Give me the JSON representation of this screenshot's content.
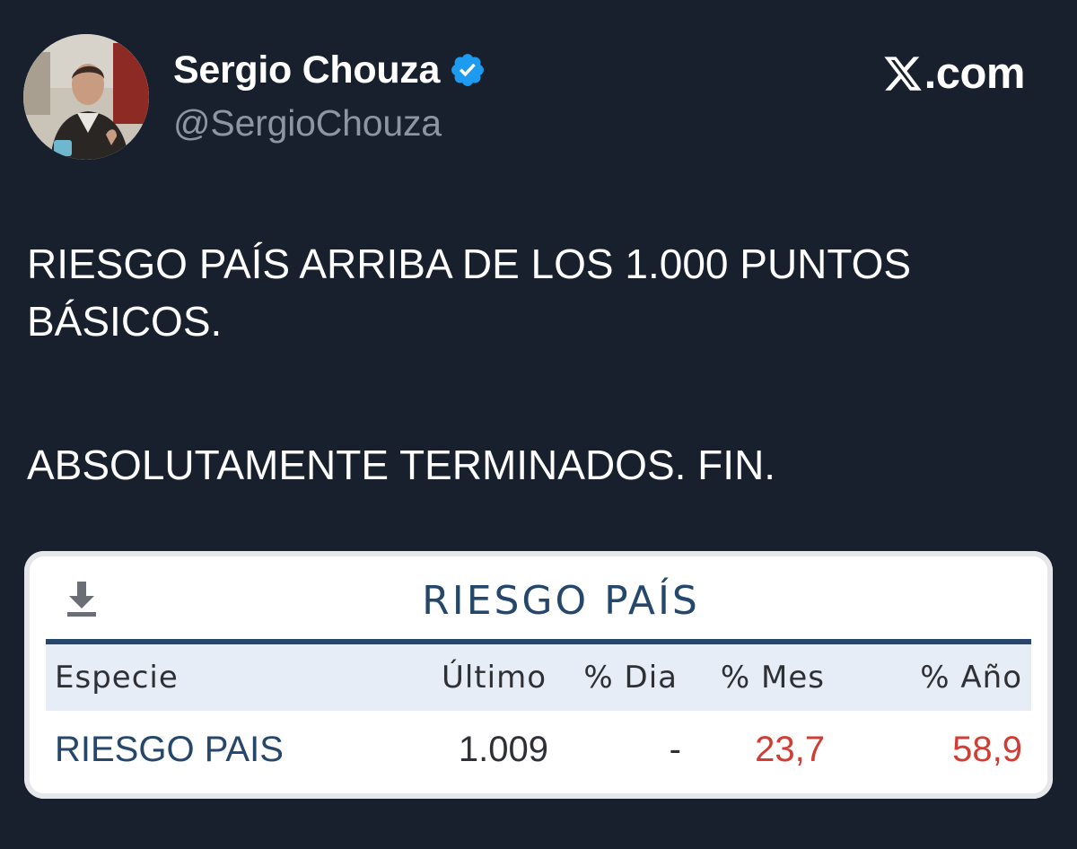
{
  "author": {
    "name": "Sergio Chouza",
    "handle": "@SergioChouza",
    "verified_color": "#1d9bf0"
  },
  "brand": {
    "site": ".com",
    "icon": "x-logo-icon"
  },
  "tweet": {
    "paragraphs": [
      "RIESGO PAÍS ARRIBA DE LOS 1.000 PUNTOS BÁSICOS.",
      "ABSOLUTAMENTE TERMINADOS. FIN."
    ]
  },
  "media": {
    "title": "RIESGO PAÍS",
    "download_icon": "download-icon",
    "accent_color": "#24476b",
    "negative_color": "#d13c34",
    "columns": [
      "Especie",
      "Último",
      "% Dia",
      "% Mes",
      "% Año"
    ],
    "row": {
      "especie": "RIESGO PAIS",
      "ultimo": "1.009",
      "dia": "-",
      "mes": "23,7",
      "anio": "58,9"
    }
  },
  "colors": {
    "background": "#18202d",
    "text": "#ffffff",
    "muted": "#8c96a3"
  }
}
